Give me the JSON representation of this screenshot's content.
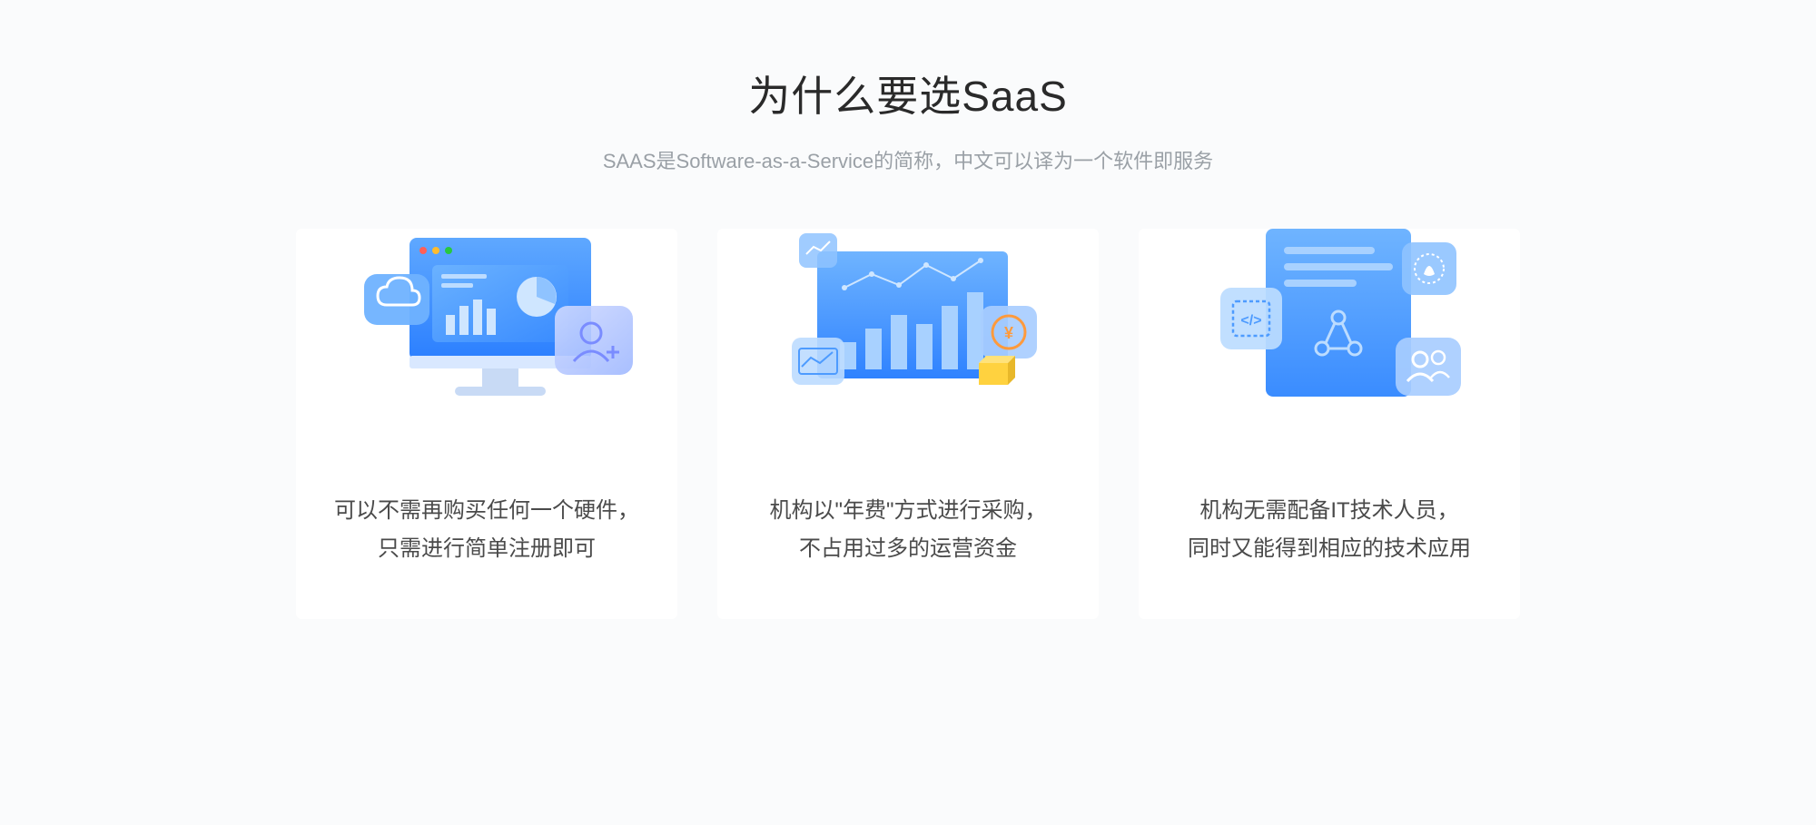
{
  "header": {
    "title": "为什么要选SaaS",
    "subtitle": "SAAS是Software-as-a-Service的简称，中文可以译为一个软件即服务"
  },
  "cards": [
    {
      "line1": "可以不需再购买任何一个硬件，",
      "line2": "只需进行简单注册即可"
    },
    {
      "line1": "机构以\"年费\"方式进行采购，",
      "line2": "不占用过多的运营资金"
    },
    {
      "line1": "机构无需配备IT技术人员，",
      "line2": "同时又能得到相应的技术应用"
    }
  ]
}
